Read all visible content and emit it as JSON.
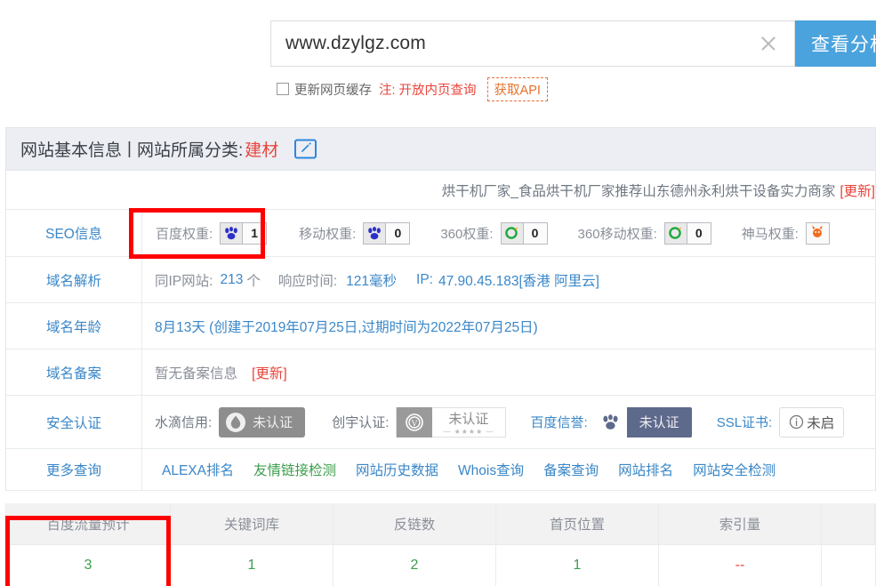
{
  "search": {
    "value": "www.dzylgz.com",
    "clear_icon": "close-icon",
    "analyze_label": "查看分析"
  },
  "options": {
    "checkbox_label": "更新网页缓存",
    "note_prefix": "注:",
    "note_link": "开放内页查询",
    "api_button": "获取API"
  },
  "card": {
    "heading_main": "网站基本信息",
    "heading_sep": "|",
    "heading_sub": "网站所属分类:",
    "category": "建材",
    "edit_icon": "edit-pencil-icon",
    "site_title": "烘干机厂家_食品烘干机厂家推荐山东德州永利烘干设备实力商家",
    "site_title_update": "[更新]"
  },
  "seo": {
    "row_label": "SEO信息",
    "items": [
      {
        "key": "百度权重:",
        "value": "1",
        "icon": "baidu-paw-icon"
      },
      {
        "key": "移动权重:",
        "value": "0",
        "icon": "baidu-paw-icon"
      },
      {
        "key": "360权重:",
        "value": "0",
        "icon": "so360-circle-icon"
      },
      {
        "key": "360移动权重:",
        "value": "0",
        "icon": "so360-circle-icon"
      },
      {
        "key": "神马权重:",
        "value": "",
        "icon": "shenma-mascot-icon"
      }
    ]
  },
  "dns": {
    "row_label": "域名解析",
    "same_ip_key": "同IP网站:",
    "same_ip_value": "213",
    "same_ip_unit": "个",
    "resp_key": "响应时间:",
    "resp_value": "121毫秒",
    "ip_key": "IP:",
    "ip_value": "47.90.45.183[香港 阿里云]"
  },
  "age": {
    "row_label": "域名年龄",
    "value": "8月13天 (创建于2019年07月25日,过期时间为2022年07月25日)"
  },
  "icp": {
    "row_label": "域名备案",
    "value": "暂无备案信息",
    "update_link": "[更新]"
  },
  "security": {
    "row_label": "安全认证",
    "items": [
      {
        "key": "水滴信用:",
        "status": "未认证",
        "icon": "water-drop-icon",
        "style": "grey"
      },
      {
        "key": "创宇认证:",
        "status": "未认证",
        "icon": "verified-v-icon",
        "style": "white",
        "stars": "— ★★★★ —"
      },
      {
        "key": "百度信誉:",
        "status": "未认证",
        "icon": "baidu-paw-icon",
        "style": "navy"
      },
      {
        "key": "SSL证书:",
        "status": "未启",
        "icon": "info-circle-icon",
        "style": "ssl"
      }
    ]
  },
  "more": {
    "row_label": "更多查询",
    "links": [
      {
        "label": "ALEXA排名",
        "color": "blue"
      },
      {
        "label": "友情链接检测",
        "color": "green"
      },
      {
        "label": "网站历史数据",
        "color": "blue"
      },
      {
        "label": "Whois查询",
        "color": "blue"
      },
      {
        "label": "备案查询",
        "color": "blue"
      },
      {
        "label": "网站排名",
        "color": "blue"
      },
      {
        "label": "网站安全检测",
        "color": "blue"
      }
    ]
  },
  "stats": {
    "headers": [
      "百度流量预计",
      "关键词库",
      "反链数",
      "首页位置",
      "索引量",
      ""
    ],
    "values": [
      "3",
      "1",
      "2",
      "1",
      "--",
      ""
    ],
    "value_colors": [
      "green",
      "green",
      "green",
      "green",
      "red",
      "green"
    ]
  },
  "annotations": {
    "highlight_color": "#FE0000",
    "boxes": [
      "baidu-weight-highlight",
      "baidu-traffic-highlight"
    ]
  }
}
